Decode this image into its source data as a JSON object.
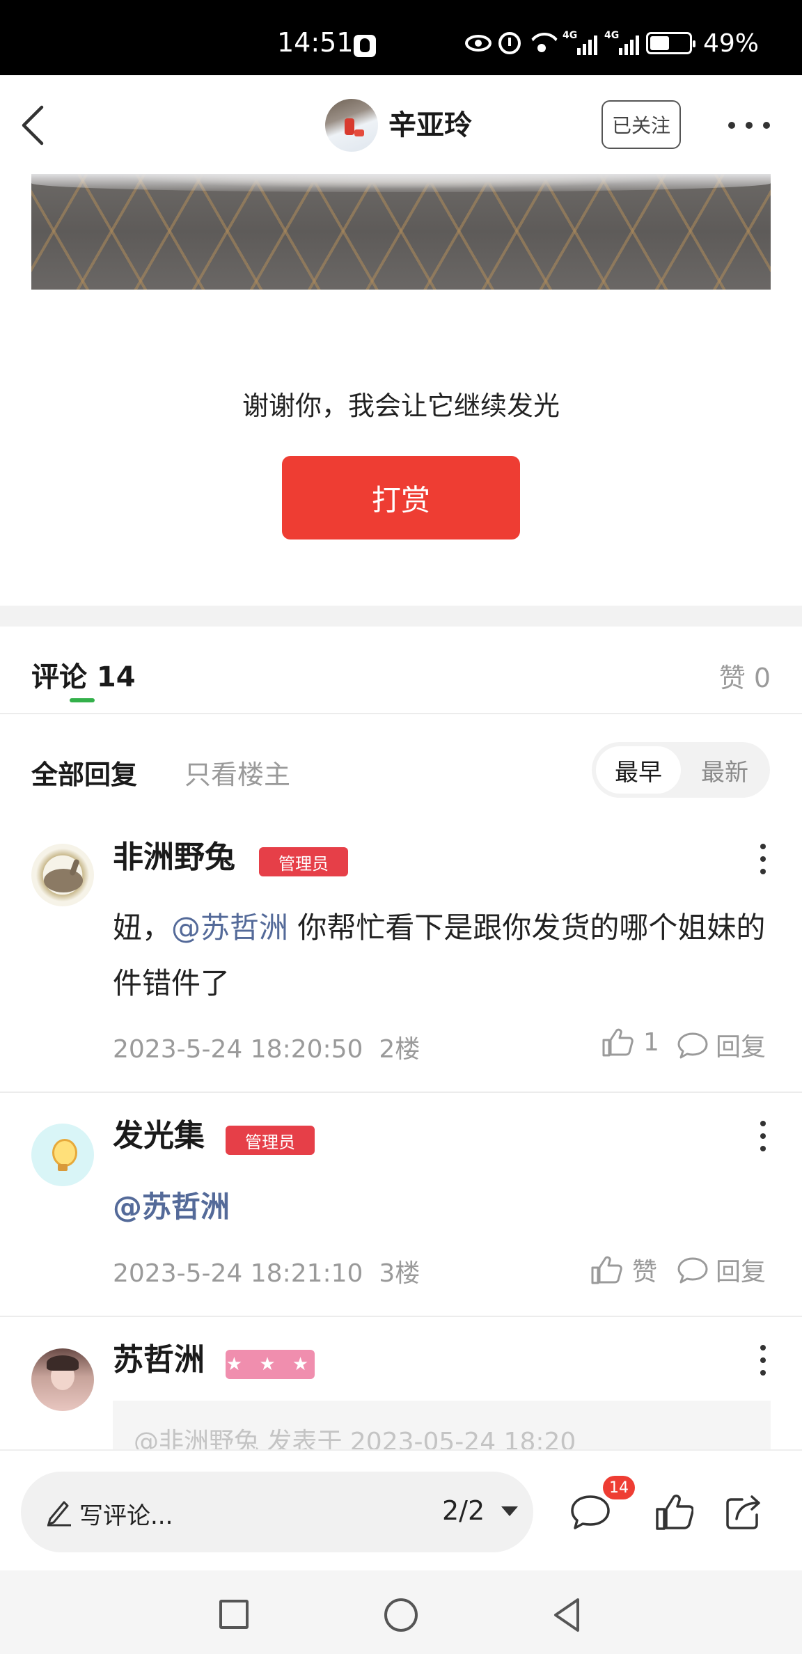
{
  "status_bar": {
    "time": "14:51",
    "battery": "49%",
    "signal_1": "4G",
    "signal_2": "4G"
  },
  "header": {
    "author_name": "辛亚玲",
    "follow_label": "已关注"
  },
  "reward": {
    "text": "谢谢你，我会让它继续发光",
    "button_label": "打赏"
  },
  "comments_header": {
    "tab_label": "评论 14",
    "likes_label": "赞 0"
  },
  "filters": {
    "all": "全部回复",
    "op_only": "只看楼主",
    "sort_earliest": "最早",
    "sort_latest": "最新"
  },
  "comments": [
    {
      "user": "非洲野兔",
      "badge": "管理员",
      "text_prefix": "妞，",
      "mention": "@苏哲洲",
      "text_suffix": " 你帮忙看下是跟你发货的哪个姐妹的件错件了",
      "time": "2023-5-24 18:20:50",
      "floor": "2楼",
      "like_label": "1",
      "reply_label": "回复"
    },
    {
      "user": "发光集",
      "badge": "管理员",
      "mention": "@苏哲洲",
      "time": "2023-5-24 18:21:10",
      "floor": "3楼",
      "like_label": "赞",
      "reply_label": "回复"
    },
    {
      "user": "苏哲洲",
      "badge": "★ ★ ★",
      "quote": "@非洲野兔 发表于 2023-05-24 18:20"
    }
  ],
  "bottom_bar": {
    "input_placeholder": "写评论...",
    "page_indicator": "2/2",
    "comment_badge": "14"
  },
  "icons": [
    "back-icon",
    "more-icon",
    "pencil-icon",
    "comment-icon",
    "thumbs-up-icon",
    "share-icon",
    "reply-icon",
    "dropdown-icon"
  ],
  "colors": {
    "accent_red": "#ee3d33",
    "admin_badge": "#e63f48",
    "star_badge": "#f08eae",
    "tab_underline": "#33b04a",
    "mention": "#546a99"
  }
}
